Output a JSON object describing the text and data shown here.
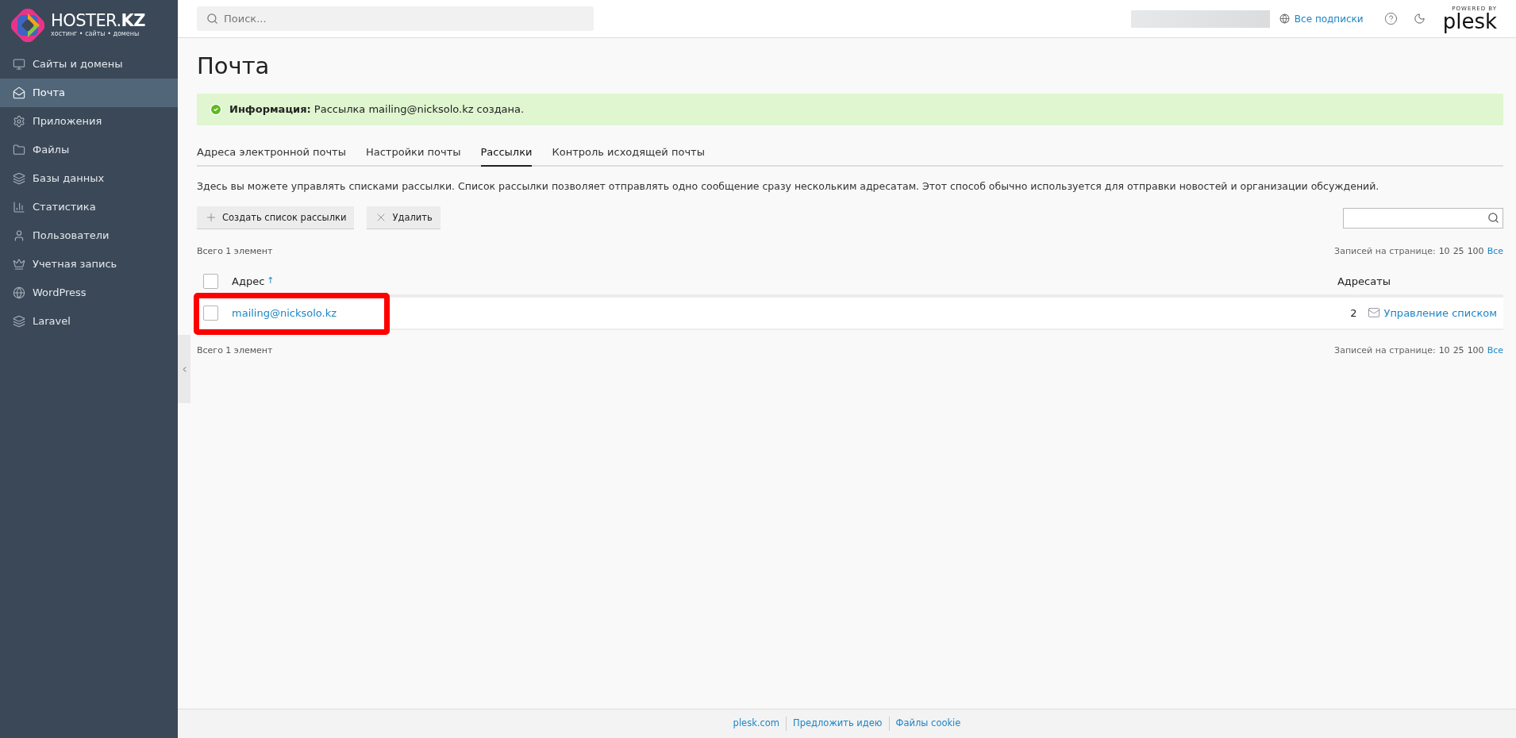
{
  "logo": {
    "name": "HOSTER.",
    "name_bold": "KZ",
    "tagline": "хостинг • сайты • домены"
  },
  "sidebar": {
    "items": [
      {
        "label": "Сайты и домены",
        "selected": false
      },
      {
        "label": "Почта",
        "selected": true
      },
      {
        "label": "Приложения",
        "selected": false
      },
      {
        "label": "Файлы",
        "selected": false
      },
      {
        "label": "Базы данных",
        "selected": false
      },
      {
        "label": "Статистика",
        "selected": false
      },
      {
        "label": "Пользователи",
        "selected": false
      },
      {
        "label": "Учетная запись",
        "selected": false
      },
      {
        "label": "WordPress",
        "selected": false
      },
      {
        "label": "Laravel",
        "selected": false
      }
    ]
  },
  "header": {
    "search_placeholder": "Поиск...",
    "subscriptions": "Все подписки",
    "powered_by": "POWERED BY",
    "brand": "plesk"
  },
  "page": {
    "title": "Почта",
    "message": {
      "label": "Информация:",
      "text": "Рассылка mailing@nicksolo.kz создана."
    },
    "tabs": [
      {
        "label": "Адреса электронной почты",
        "selected": false
      },
      {
        "label": "Настройки почты",
        "selected": false
      },
      {
        "label": "Рассылки",
        "selected": true
      },
      {
        "label": "Контроль исходящей почты",
        "selected": false
      }
    ],
    "description": "Здесь вы можете управлять списками рассылки. Список рассылки позволяет отправлять одно сообщение сразу нескольким адресатам. Этот способ обычно используется для отправки новостей и организации обсуждений.",
    "buttons": [
      {
        "label": "Создать список рассылки"
      },
      {
        "label": "Удалить"
      }
    ],
    "pagers": [
      {
        "total": "Всего 1 элемент",
        "per_page_label": "Записей на странице:",
        "options": [
          {
            "label": "10",
            "selected": false
          },
          {
            "label": "25",
            "selected": false
          },
          {
            "label": "100",
            "selected": false
          },
          {
            "label": "Все",
            "selected": true
          }
        ]
      },
      {
        "total": "Всего 1 элемент",
        "per_page_label": "Записей на странице:",
        "options": [
          {
            "label": "10",
            "selected": false
          },
          {
            "label": "25",
            "selected": false
          },
          {
            "label": "100",
            "selected": false
          },
          {
            "label": "Все",
            "selected": true
          }
        ]
      }
    ],
    "table": {
      "select_all_checked": false,
      "columns": [
        {
          "label": "Адрес",
          "sort": "↑"
        },
        {
          "label": "Адресаты"
        }
      ],
      "rows": [
        {
          "address": "mailing@nicksolo.kz",
          "recipients": "2",
          "action": "Управление списком",
          "checked": false,
          "highlighted": true
        }
      ]
    }
  },
  "footer": {
    "links": [
      "plesk.com",
      "Предложить идею",
      "Файлы cookie"
    ]
  }
}
